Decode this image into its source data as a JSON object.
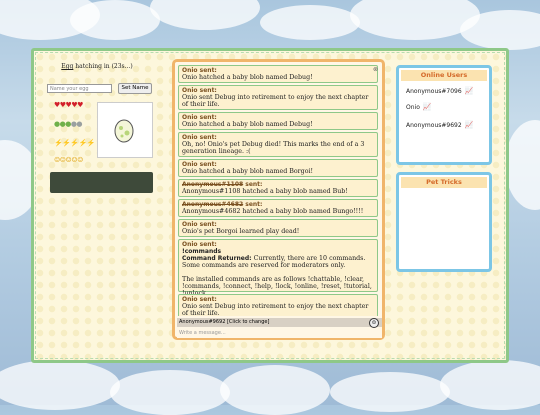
{
  "egg": {
    "status_prefix": "Egg",
    "status_rest": " hatching in (23s...)",
    "name_placeholder": "Name your egg",
    "set_name_label": "Set Name"
  },
  "stats": {
    "hearts": "♥♥♥♥♥",
    "food_full": "●●●",
    "food_empty": "●●",
    "energy": "⚡⚡⚡⚡⚡",
    "happy": "☺☺☺☺☺"
  },
  "chat": {
    "close_label": "⊗",
    "messages": [
      {
        "sender": "Onio",
        "suffix": " sent:",
        "text": "Onio hatched a baby blob named Debug!"
      },
      {
        "sender": "Onio",
        "suffix": " sent:",
        "text": "Onio sent Debug into retirement to enjoy the next chapter of their life."
      },
      {
        "sender": "Onio",
        "suffix": " sent:",
        "text": "Onio hatched a baby blob named Debug!"
      },
      {
        "sender": "Onio",
        "suffix": " sent:",
        "text": "Oh, no! Onio's pet Debug died! This marks the end of a 3 generation lineage. :("
      },
      {
        "sender": "Onio",
        "suffix": " sent:",
        "text": "Onio hatched a baby blob named Borgoi!"
      },
      {
        "sender": "Anonymous#1108",
        "suffix": " sent:",
        "text": "Anonymous#1108 hatched a baby blob named Bub!"
      },
      {
        "sender": "Anonymous#4682",
        "suffix": " sent:",
        "text": "Anonymous#4682 hatched a baby blob named Bungo!!!!"
      },
      {
        "sender": "Onio",
        "suffix": " sent:",
        "text": "Onio's pet Borgoi learned play dead!"
      },
      {
        "sender": "Onio",
        "suffix": " sent:",
        "command": "!commands",
        "returned_label": "Command Returned:",
        "returned_text": " Currently, there are 10 commands. Some commands are reserved for moderators only.",
        "text2": "The installed commands are as follows !chattable, !clear, !commands, !connect, !help, !lock, !online, !reset, !tutorial, !unlock"
      },
      {
        "sender": "Onio",
        "suffix": " sent:",
        "text": "Onio sent Debug into retirement to enjoy the next chapter of their life."
      }
    ],
    "user_line": "Anonymous#9692 [Click to change]",
    "emoji_label": "☺",
    "input_placeholder": "Write a message..."
  },
  "online": {
    "title": "Online Users",
    "users": [
      "Anonymous#7096",
      "Onio",
      "Anonymous#9692"
    ],
    "icon": "chart-icon"
  },
  "pets": {
    "title": "Pet Tricks"
  }
}
